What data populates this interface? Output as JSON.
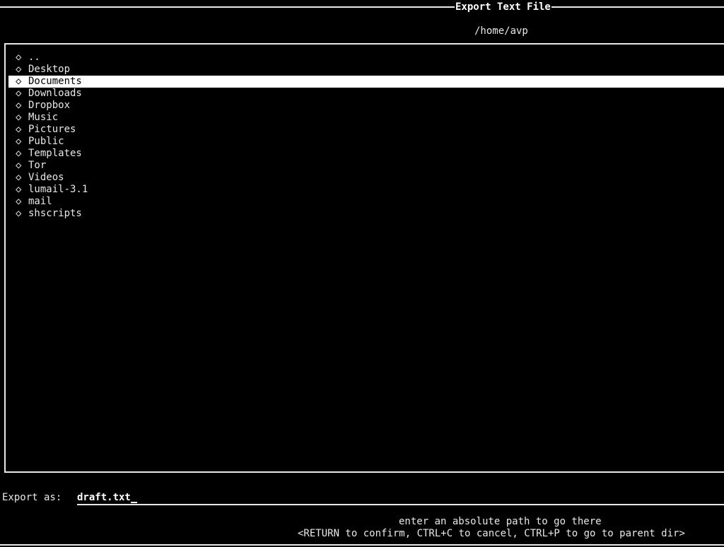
{
  "dialog": {
    "title": "Export Text File",
    "current_dir": "/home/avp"
  },
  "file_list": {
    "bullet_icon": "◇",
    "selected_index": 2,
    "items": [
      {
        "name": ".."
      },
      {
        "name": "Desktop"
      },
      {
        "name": "Documents"
      },
      {
        "name": "Downloads"
      },
      {
        "name": "Dropbox"
      },
      {
        "name": "Music"
      },
      {
        "name": "Pictures"
      },
      {
        "name": "Public"
      },
      {
        "name": "Templates"
      },
      {
        "name": "Tor"
      },
      {
        "name": "Videos"
      },
      {
        "name": "lumail-3.1"
      },
      {
        "name": "mail"
      },
      {
        "name": "shscripts"
      }
    ]
  },
  "prompt": {
    "label": "Export as:",
    "value": "draft.txt"
  },
  "hints": {
    "line1": "enter an absolute path to go there",
    "line2": "<RETURN to confirm, CTRL+C to cancel, CTRL+P to go to parent dir>"
  }
}
